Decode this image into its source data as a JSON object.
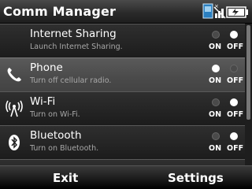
{
  "app": {
    "title": "Comm Manager"
  },
  "status_icons": [
    "sim-icon",
    "signal-off-icon",
    "battery-icon"
  ],
  "toggle_labels": {
    "on": "ON",
    "off": "OFF"
  },
  "items": [
    {
      "title": "Internet Sharing",
      "subtitle": "Launch Internet Sharing.",
      "icon": "none",
      "state": "off"
    },
    {
      "title": "Phone",
      "subtitle": "Turn off cellular radio.",
      "icon": "phone-icon",
      "state": "on"
    },
    {
      "title": "Wi-Fi",
      "subtitle": "Turn on Wi-Fi.",
      "icon": "wifi-icon",
      "state": "off"
    },
    {
      "title": "Bluetooth",
      "subtitle": "Turn on Bluetooth.",
      "icon": "bluetooth-icon",
      "state": "off"
    }
  ],
  "softkeys": {
    "left": "Exit",
    "right": "Settings"
  }
}
